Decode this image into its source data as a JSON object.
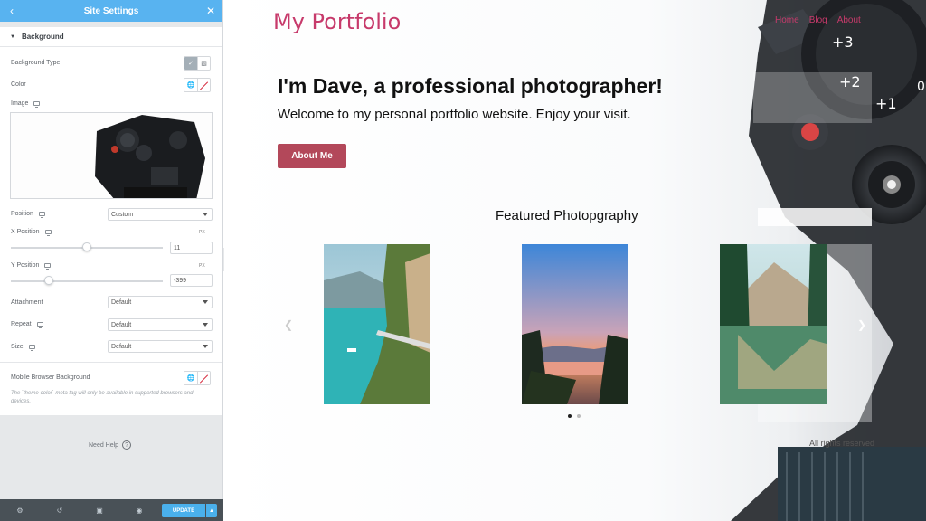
{
  "panel": {
    "title": "Site Settings",
    "section_title": "Background",
    "labels": {
      "background_type": "Background Type",
      "color": "Color",
      "image": "Image",
      "position": "Position",
      "x_position": "X Position",
      "y_position": "Y Position",
      "attachment": "Attachment",
      "repeat": "Repeat",
      "size": "Size",
      "mobile_browser_background": "Mobile Browser Background"
    },
    "selects": {
      "position": "Custom",
      "attachment": "Default",
      "repeat": "Default",
      "size": "Default"
    },
    "units": {
      "x": "PX",
      "y": "PX"
    },
    "x_value": "11",
    "y_value": "-399",
    "x_slider_fraction": 0.5,
    "y_slider_fraction": 0.25,
    "note": "The `theme-color` meta tag will only be available in supported browsers and devices.",
    "need_help": "Need Help",
    "update_label": "UPDATE",
    "accent_color": "#58b3f0",
    "footer_color": "#495157"
  },
  "site": {
    "title": "My Portfolio",
    "nav": [
      "Home",
      "Blog",
      "About"
    ],
    "hero_heading": "I'm Dave, a professional photographer!",
    "hero_sub": "Welcome to my personal portfolio website. Enjoy your visit.",
    "button_label": "About Me",
    "featured_title": "Featured Photopgraphy",
    "footer": "All rights reserved",
    "brand_color": "#c73a6b",
    "button_color": "#b3485a",
    "carousel": {
      "slides_total": 2,
      "active_slide": 1
    }
  }
}
